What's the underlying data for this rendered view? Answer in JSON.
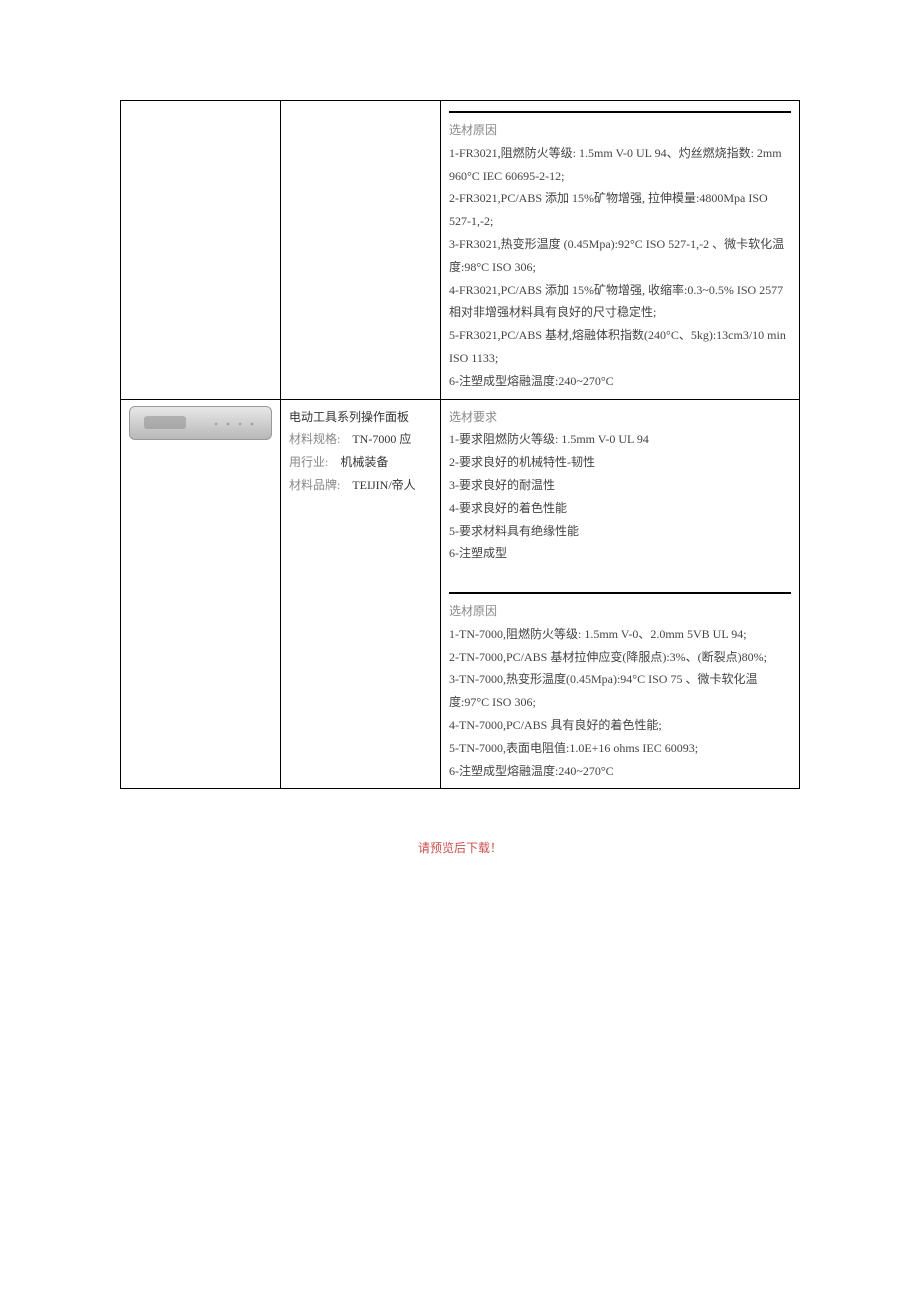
{
  "row1": {
    "reason_title": "选材原因",
    "reason_lines": [
      "1-FR3021,阻燃防火等级: 1.5mm V-0 UL 94、灼丝燃烧指数: 2mm 960°C IEC 60695-2-12;",
      "2-FR3021,PC/ABS 添加 15%矿物增强, 拉伸模量:4800Mpa ISO 527-1,-2;",
      "3-FR3021,热变形温度 (0.45Mpa):92°C ISO 527-1,-2 、微卡软化温度:98°C ISO 306;",
      "4-FR3021,PC/ABS 添加 15%矿物增强, 收缩率:0.3~0.5% ISO 2577 相对非增强材料具有良好的尺寸稳定性;",
      "5-FR3021,PC/ABS 基材,熔融体积指数(240°C、5kg):13cm3/10 min ISO 1133;",
      "6-注塑成型熔融温度:240~270°C"
    ]
  },
  "row2": {
    "mid": {
      "title": "电动工具系列操作面板",
      "spec_label": "材料规格: ",
      "spec_value": "TN-7000 应",
      "industry_label": "用行业: ",
      "industry_value": "机械装备",
      "brand_label": "材料品牌: ",
      "brand_value": "TEIJIN/帝人"
    },
    "req_title": "选材要求",
    "req_lines": [
      "1-要求阻燃防火等级: 1.5mm V-0 UL 94",
      "2-要求良好的机械特性-韧性",
      "3-要求良好的耐温性",
      "4-要求良好的着色性能",
      "5-要求材料具有绝缘性能",
      "6-注塑成型"
    ],
    "reason_title": "选材原因",
    "reason_lines": [
      "1-TN-7000,阻燃防火等级: 1.5mm V-0、2.0mm 5VB UL 94;",
      "2-TN-7000,PC/ABS 基材拉伸应变(降服点):3%、(断裂点)80%;",
      "3-TN-7000,热变形温度(0.45Mpa):94°C ISO 75 、微卡软化温度:97°C ISO 306;",
      "4-TN-7000,PC/ABS 具有良好的着色性能;",
      "5-TN-7000,表面电阻值:1.0E+16 ohms IEC 60093;",
      "6-注塑成型熔融温度:240~270°C"
    ]
  },
  "footer": "请预览后下载！"
}
